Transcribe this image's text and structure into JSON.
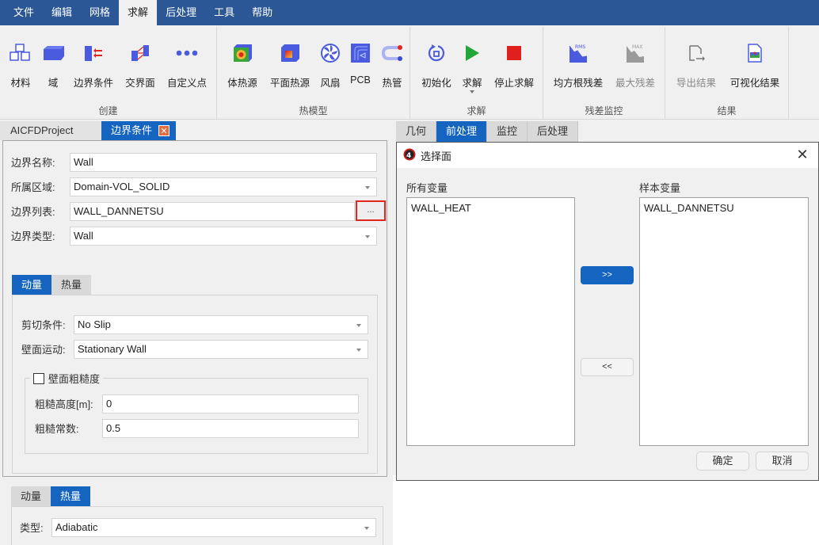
{
  "menubar": {
    "items": [
      {
        "label": "文件",
        "active": false
      },
      {
        "label": "编辑",
        "active": false
      },
      {
        "label": "网格",
        "active": false
      },
      {
        "label": "求解",
        "active": true
      },
      {
        "label": "后处理",
        "active": false
      },
      {
        "label": "工具",
        "active": false
      },
      {
        "label": "帮助",
        "active": false
      }
    ]
  },
  "ribbon": {
    "groups": [
      {
        "label": "创建",
        "buttons": [
          {
            "label": "材料",
            "icon": "material-cubes-icon"
          },
          {
            "label": "域",
            "icon": "domain-box-icon"
          },
          {
            "label": "边界条件",
            "icon": "boundary-condition-icon"
          },
          {
            "label": "交界面",
            "icon": "interface-icon"
          },
          {
            "label": "自定义点",
            "icon": "more-dots-icon"
          }
        ]
      },
      {
        "label": "热模型",
        "buttons": [
          {
            "label": "体热源",
            "icon": "volume-heat-source-icon"
          },
          {
            "label": "平面热源",
            "icon": "planar-heat-source-icon"
          },
          {
            "label": "风扇",
            "icon": "fan-icon"
          },
          {
            "label": "PCB",
            "icon": "pcb-icon"
          },
          {
            "label": "热管",
            "icon": "heat-pipe-icon"
          }
        ]
      },
      {
        "label": "求解",
        "buttons": [
          {
            "label": "初始化",
            "icon": "initialize-icon"
          },
          {
            "label": "求解",
            "icon": "play-icon"
          },
          {
            "label": "停止求解",
            "icon": "stop-icon"
          }
        ]
      },
      {
        "label": "残差监控",
        "buttons": [
          {
            "label": "均方根残差",
            "icon": "rms-residual-icon"
          },
          {
            "label": "最大残差",
            "icon": "max-residual-icon"
          }
        ]
      },
      {
        "label": "结果",
        "buttons": [
          {
            "label": "导出结果",
            "icon": "export-result-icon"
          },
          {
            "label": "可视化结果",
            "icon": "visualize-result-icon"
          }
        ]
      }
    ]
  },
  "doc_tabs": [
    {
      "label": "AICFDProject",
      "active": false
    },
    {
      "label": "边界条件",
      "active": true,
      "closable": true
    }
  ],
  "boundary_form": {
    "name_label": "边界名称:",
    "name_value": "Wall",
    "domain_label": "所属区域:",
    "domain_value": "Domain-VOL_SOLID",
    "list_label": "边界列表:",
    "list_value": "WALL_DANNETSU",
    "browse_label": "...",
    "type_label": "边界类型:",
    "type_value": "Wall"
  },
  "momentum_section": {
    "tabs": [
      {
        "label": "动量",
        "active": true
      },
      {
        "label": "热量",
        "active": false
      }
    ],
    "shear_label": "剪切条件:",
    "shear_value": "No Slip",
    "motion_label": "壁面运动:",
    "motion_value": "Stationary Wall",
    "roughness_title": "壁面粗糙度",
    "roughness_checked": false,
    "height_label": "粗糙高度[m]:",
    "height_value": "0",
    "constant_label": "粗糙常数:",
    "constant_value": "0.5"
  },
  "thermal_section": {
    "tabs": [
      {
        "label": "动量",
        "active": false
      },
      {
        "label": "热量",
        "active": true
      }
    ],
    "type_label": "类型:",
    "type_value": "Adiabatic"
  },
  "right_tabs": [
    {
      "label": "几何",
      "active": false
    },
    {
      "label": "前处理",
      "active": true
    },
    {
      "label": "监控",
      "active": false
    },
    {
      "label": "后处理",
      "active": false
    }
  ],
  "dialog": {
    "title": "选择面",
    "all_label": "所有变量",
    "all_items": [
      "WALL_HEAT"
    ],
    "sample_label": "样本变量",
    "sample_items": [
      "WALL_DANNETSU"
    ],
    "add_label": ">>",
    "remove_label": "<<",
    "ok_label": "确定",
    "cancel_label": "取消"
  }
}
